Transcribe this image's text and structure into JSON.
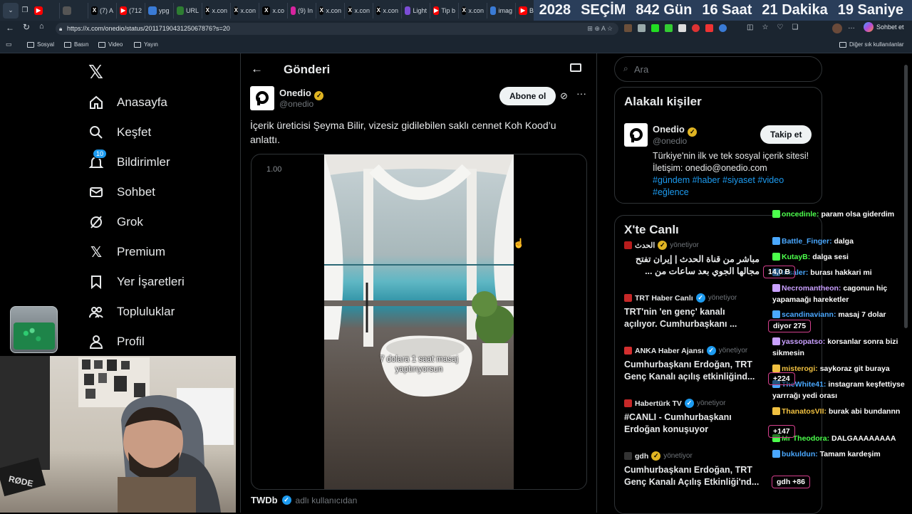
{
  "browser": {
    "tabs": [
      {
        "label": "",
        "icon": "youtube-icon",
        "color": "#ff0000"
      },
      {
        "label": "",
        "icon": "mute-icon",
        "color": "#555"
      },
      {
        "label": "(7) A",
        "icon": "x-icon",
        "color": "#000"
      },
      {
        "label": "(712",
        "icon": "youtube-icon",
        "color": "#ff0000"
      },
      {
        "label": "ypg",
        "icon": "globe-icon",
        "color": "#3a7bd5"
      },
      {
        "label": "URL",
        "icon": "url-icon",
        "color": "#2e7d32"
      },
      {
        "label": "x.con",
        "icon": "x-icon",
        "color": "#000"
      },
      {
        "label": "x.con",
        "icon": "x-icon",
        "color": "#000"
      },
      {
        "label": "x.co",
        "icon": "x-icon",
        "color": "#000"
      },
      {
        "label": "(9) In",
        "icon": "instagram-icon",
        "color": "#d6249f"
      },
      {
        "label": "x.con",
        "icon": "x-icon",
        "color": "#000"
      },
      {
        "label": "x.con",
        "icon": "x-icon",
        "color": "#000"
      },
      {
        "label": "x.con",
        "icon": "x-icon",
        "color": "#000"
      },
      {
        "label": "Light",
        "icon": "pen-icon",
        "color": "#7b4dd6"
      },
      {
        "label": "Tip b",
        "icon": "youtube-icon",
        "color": "#ff0000"
      },
      {
        "label": "x.con",
        "icon": "x-icon",
        "color": "#000"
      },
      {
        "label": "imag",
        "icon": "globe-icon",
        "color": "#3a7bd5"
      },
      {
        "label": "Bac",
        "icon": "youtube-icon",
        "color": "#ff0000"
      }
    ],
    "countdown": [
      "2028",
      "SEÇİM",
      "842 Gün",
      "16 Saat",
      "21 Dakika",
      "19 Saniye"
    ],
    "url": "https://x.com/onedio/status/2011719043125067876?s=20",
    "copilot_label": "Sohbet et",
    "bookmarks": [
      "Sosyal",
      "Basın",
      "Video",
      "Yayın"
    ],
    "bookmarks_right": "Diğer sık kullanılanlar"
  },
  "nav": {
    "items": [
      {
        "label": "Anasayfa",
        "icon": "home-icon"
      },
      {
        "label": "Keşfet",
        "icon": "search-icon"
      },
      {
        "label": "Bildirimler",
        "icon": "bell-icon",
        "badge": "10"
      },
      {
        "label": "Sohbet",
        "icon": "mail-icon"
      },
      {
        "label": "Grok",
        "icon": "grok-icon"
      },
      {
        "label": "Premium",
        "icon": "x-icon"
      },
      {
        "label": "Yer İşaretleri",
        "icon": "bookmark-icon"
      },
      {
        "label": "Topluluklar",
        "icon": "people-icon"
      },
      {
        "label": "Profil",
        "icon": "person-icon"
      }
    ]
  },
  "post": {
    "header": "Gönderi",
    "author_name": "Onedio",
    "author_handle": "@onedio",
    "subscribe": "Abone ol",
    "text": "İçerik üreticisi Şeyma Bilir, vizesiz gidilebilen saklı cennet Koh Kood’u anlattı.",
    "video_speed": "1.00",
    "caption": "7 dolara 1 saat masaj yaptırıyorsun",
    "reply_name": "TWDb",
    "reply_handle": "adlı kullanıcıdan"
  },
  "sidebar": {
    "search_placeholder": "Ara",
    "related_title": "Alakalı kişiler",
    "related": {
      "name": "Onedio",
      "handle": "@onedio",
      "follow": "Takip et",
      "bio": "Türkiye'nin ilk ve tek sosyal içerik sitesi! İletişim: onedio@onedio.com",
      "tags": "#gündem #haber #siyaset #video #eğlence"
    },
    "live_title": "X'te Canlı",
    "live": [
      {
        "name": "الحدث",
        "status": "yönetiyor",
        "title": "مباشر من قناة الحدث | إيران تفتح مجالها الجوي بعد ساعات من ...",
        "color": "#b71c1c",
        "verified": "gold"
      },
      {
        "name": "TRT Haber Canlı",
        "status": "yönetiyor",
        "title": "TRT'nin 'en genç' kanalı açılıyor.  Cumhurbaşkanı ...",
        "color": "#c62828",
        "verified": "blue"
      },
      {
        "name": "ANKA Haber Ajansı",
        "status": "yönetiyor",
        "title": "Cumhurbaşkanı Erdoğan, TRT Genç Kanalı açılış etkinliğind...",
        "color": "#d32f2f",
        "verified": "blue"
      },
      {
        "name": "Habertürk TV",
        "status": "yönetiyor",
        "title": "#CANLI - Cumhurbaşkanı Erdoğan konuşuyor",
        "color": "#c62828",
        "verified": "blue"
      },
      {
        "name": "gdh",
        "status": "yönetiyor",
        "title": "Cumhurbaşkanı Erdoğan, TRT Genç Kanalı Açılış Etkinliği'nd...",
        "color": "#333",
        "verified": "gold"
      }
    ]
  },
  "chat": [
    {
      "user": "oncedinle:",
      "msg": "param olsa giderdim",
      "color": "#4cff4c"
    },
    {
      "user": "Battle_Finger:",
      "msg": "dalga",
      "color": "#4aa8ff"
    },
    {
      "user": "KutayB:",
      "msg": "dalga sesi",
      "color": "#4cff4c"
    },
    {
      "user": "Insaler:",
      "msg": "burası hakkari mi",
      "color": "#4aa8ff"
    },
    {
      "user": "Necromantheon:",
      "msg": "cagonun hiç yapamaağı hareketler",
      "color": "#c9a0ff"
    },
    {
      "user": "scandinaviann:",
      "msg": "masaj 7 dolar",
      "color": "#4aa8ff"
    },
    {
      "user": "yassopatso:",
      "msg": "korsanlar sonra bizi sikmesin",
      "color": "#c9a0ff"
    },
    {
      "user": "misterogi:",
      "msg": "saykoraz git buraya",
      "color": "#f0c040"
    },
    {
      "user": "TheWhite41:",
      "msg": "instagram keşfettiyse yarrrağı yedi orası",
      "color": "#4aa8ff"
    },
    {
      "user": "ThanatosVII:",
      "msg": "burak abi bundannn",
      "color": "#f0c040"
    },
    {
      "user": "Mr Theodora:",
      "msg": "DALGAAAAAAAA",
      "color": "#4cff4c"
    },
    {
      "user": "bukuldun:",
      "msg": "Tamam kardeşim",
      "color": "#4aa8ff"
    }
  ],
  "viewers": [
    {
      "label": "14,0 B"
    },
    {
      "label": "diyor 275"
    },
    {
      "label": "+224"
    },
    {
      "label": "+147"
    },
    {
      "label": "gdh +86"
    }
  ]
}
